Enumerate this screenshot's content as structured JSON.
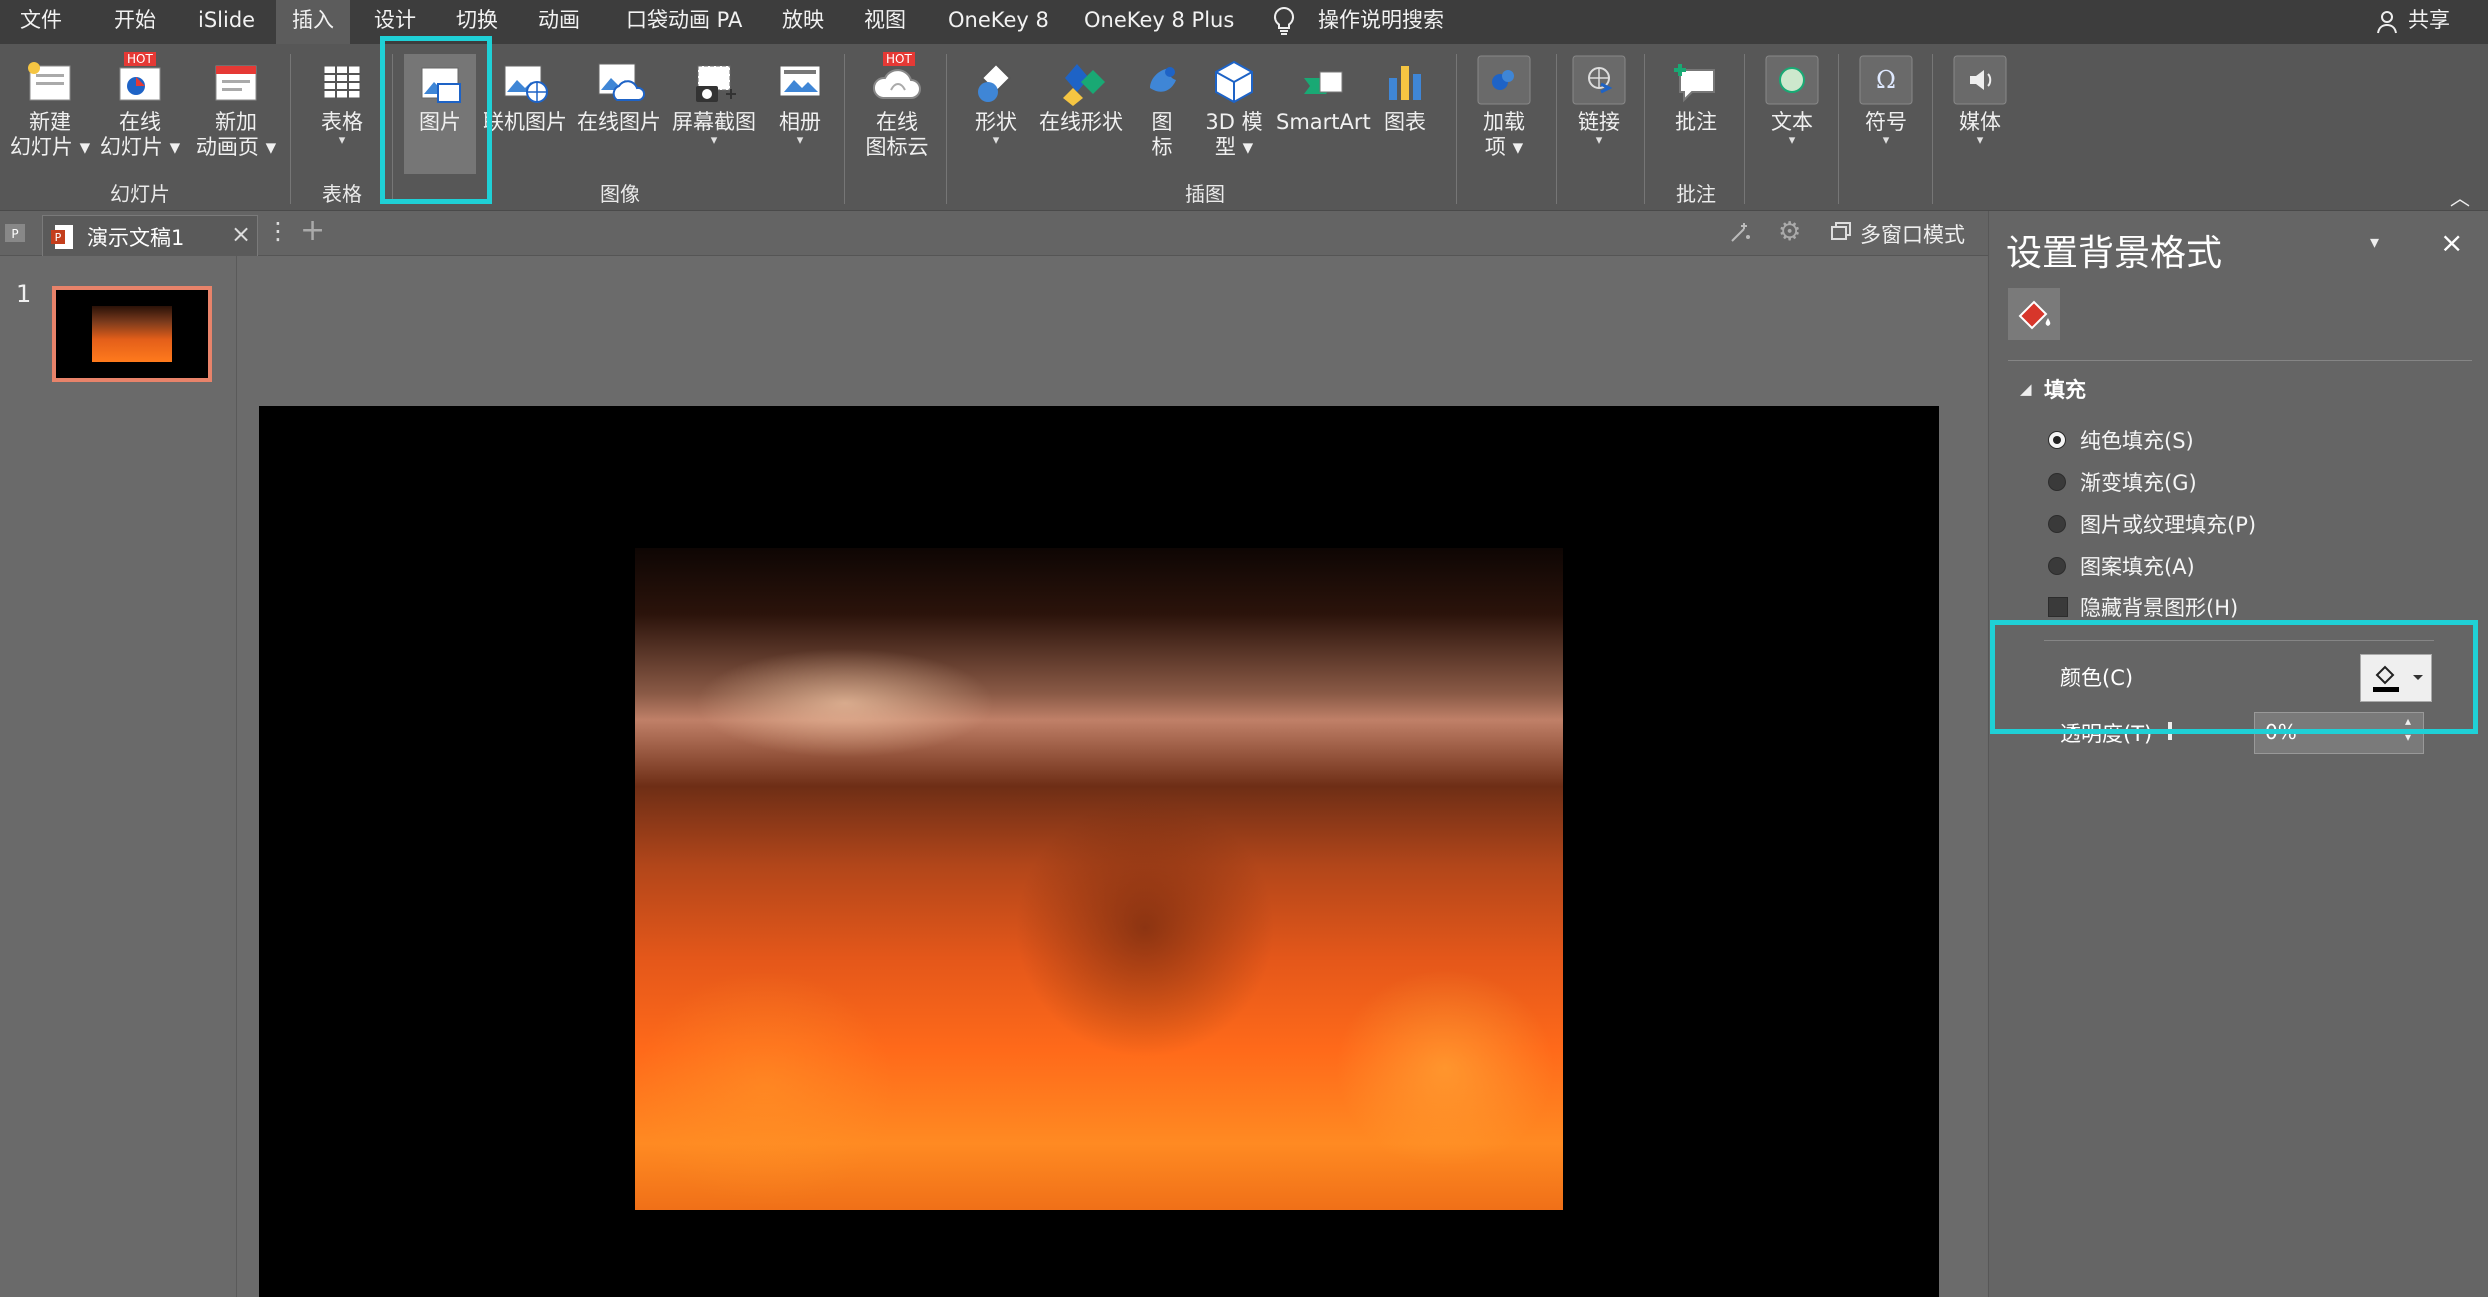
{
  "menubar": {
    "items": [
      "文件",
      "开始",
      "iSlide",
      "插入",
      "设计",
      "切换",
      "动画",
      "口袋动画 PA",
      "放映",
      "视图",
      "OneKey 8",
      "OneKey 8 Plus"
    ],
    "search_text": "操作说明搜索",
    "share_label": "共享"
  },
  "ribbon": {
    "slides": {
      "new_l1": "新建",
      "new_l2": "幻灯片",
      "online_l1": "在线",
      "online_l2": "幻灯片",
      "anim_l1": "新加",
      "anim_l2": "动画页",
      "group": "幻灯片",
      "hot": "HOT"
    },
    "table": {
      "label": "表格",
      "group": "表格"
    },
    "image": {
      "picture": "图片",
      "linked": "联机图片",
      "online": "在线图片",
      "screenshot": "屏幕截图",
      "album": "相册",
      "group": "图像"
    },
    "iconcloud": {
      "l1": "在线",
      "l2": "图标云",
      "hot": "HOT"
    },
    "illus": {
      "shapes": "形状",
      "online_shapes": "在线形状",
      "icons_l1": "图",
      "icons_l2": "标",
      "model_l1": "3D 模",
      "model_l2": "型",
      "smartart": "SmartArt",
      "chart": "图表",
      "group": "插图"
    },
    "addins": {
      "l1": "加载",
      "l2": "项"
    },
    "link": {
      "label": "链接"
    },
    "comment": {
      "label": "批注",
      "group": "批注"
    },
    "text": {
      "label": "文本"
    },
    "symbol": {
      "label": "符号"
    },
    "media": {
      "label": "媒体"
    }
  },
  "tabbar": {
    "doc_tab": "演示文稿1",
    "multiwin": "多窗口模式"
  },
  "thumbs": {
    "slide_number": "1"
  },
  "pane": {
    "title": "设置背景格式",
    "section": "填充",
    "options": [
      "纯色填充(S)",
      "渐变填充(G)",
      "图片或纹理填充(P)",
      "图案填充(A)"
    ],
    "selected_option": "纯色填充(S)",
    "hide_bg": "隐藏背景图形(H)",
    "color_label": "颜色(C)",
    "transparency_label": "透明度(T)",
    "transparency_value": "0%"
  },
  "colors": {
    "highlight": "#1fd0d6",
    "menubar": "#3d3d3d",
    "ribbon": "#575757",
    "thumb_border": "#e8836a",
    "hot": "#e53935"
  },
  "icons": [
    "new-slide-icon",
    "online-slide-icon",
    "new-anim-icon",
    "table-icon",
    "picture-icon",
    "linked-picture-icon",
    "online-picture-icon",
    "screenshot-icon",
    "album-icon",
    "icon-cloud-icon",
    "shapes-icon",
    "online-shapes-icon",
    "icons-icon",
    "3d-model-icon",
    "smartart-icon",
    "chart-icon",
    "addins-icon",
    "link-icon",
    "comment-icon",
    "text-icon",
    "symbol-icon",
    "media-icon",
    "lightbulb-icon",
    "user-icon",
    "paint-bucket-icon"
  ]
}
